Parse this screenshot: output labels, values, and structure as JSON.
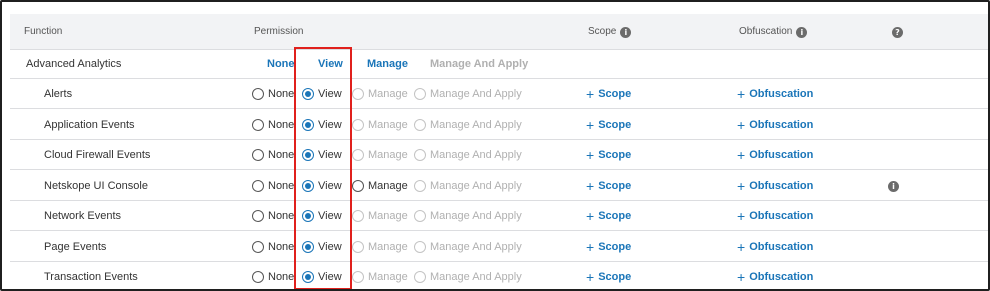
{
  "header": {
    "function": "Function",
    "permission": "Permission",
    "scope": "Scope",
    "obfuscation": "Obfuscation",
    "info_glyph": "i",
    "help_glyph": "?"
  },
  "group": {
    "name": "Advanced Analytics",
    "none": "None",
    "view": "View",
    "manage": "Manage",
    "manage_apply": "Manage And Apply"
  },
  "options": {
    "none": "None",
    "view": "View",
    "manage": "Manage",
    "manage_apply": "Manage And Apply"
  },
  "actions": {
    "scope": "Scope",
    "obfuscation": "Obfuscation",
    "plus": "+"
  },
  "rows": [
    {
      "name": "Alerts",
      "selected": "View",
      "manage_enabled": false,
      "info": false
    },
    {
      "name": "Application Events",
      "selected": "View",
      "manage_enabled": false,
      "info": false
    },
    {
      "name": "Cloud Firewall Events",
      "selected": "View",
      "manage_enabled": false,
      "info": false
    },
    {
      "name": "Netskope UI Console",
      "selected": "View",
      "manage_enabled": true,
      "info": true
    },
    {
      "name": "Network Events",
      "selected": "View",
      "manage_enabled": false,
      "info": false
    },
    {
      "name": "Page Events",
      "selected": "View",
      "manage_enabled": false,
      "info": false
    },
    {
      "name": "Transaction Events",
      "selected": "View",
      "manage_enabled": false,
      "info": false
    }
  ],
  "colors": {
    "accent": "#1a75b8",
    "highlight": "#e0201c",
    "disabled": "#b0b0b0"
  }
}
